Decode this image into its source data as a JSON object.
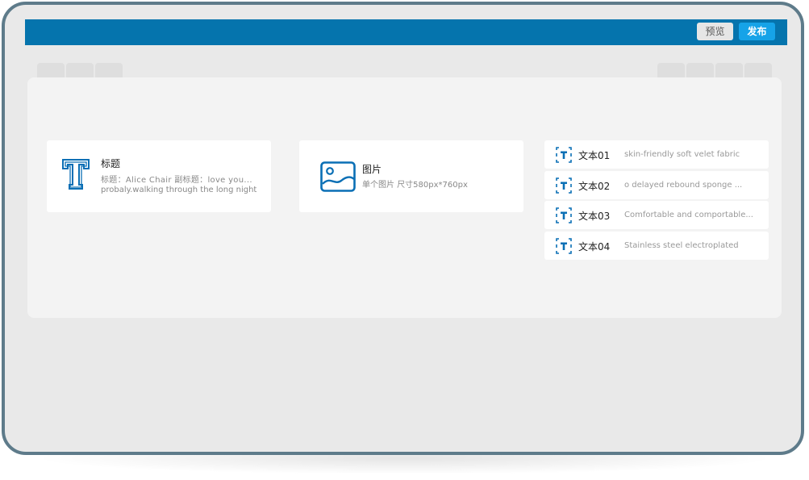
{
  "header": {
    "preview_label": "预览",
    "publish_label": "发布"
  },
  "components": {
    "title_card": {
      "icon": "text-title-icon",
      "heading": "标题",
      "line1": "标题：Alice Chair 副标题：love you...",
      "line2": "probaly.walking through the long night"
    },
    "image_card": {
      "icon": "image-icon",
      "heading": "图片",
      "subtitle": "单个图片 尺寸580px*760px"
    },
    "text_items": [
      {
        "label": "文本01",
        "desc": "skin-friendly soft velet fabric"
      },
      {
        "label": "文本02",
        "desc": "o delayed rebound sponge ..."
      },
      {
        "label": "文本03",
        "desc": "Comfortable and comportable..."
      },
      {
        "label": "文本04",
        "desc": "Stainless steel electroplated"
      }
    ]
  },
  "colors": {
    "primary": "#0574ad",
    "publish": "#16a3e8",
    "frame": "#5e7b8a",
    "icon_blue": "#0a6fb5"
  }
}
